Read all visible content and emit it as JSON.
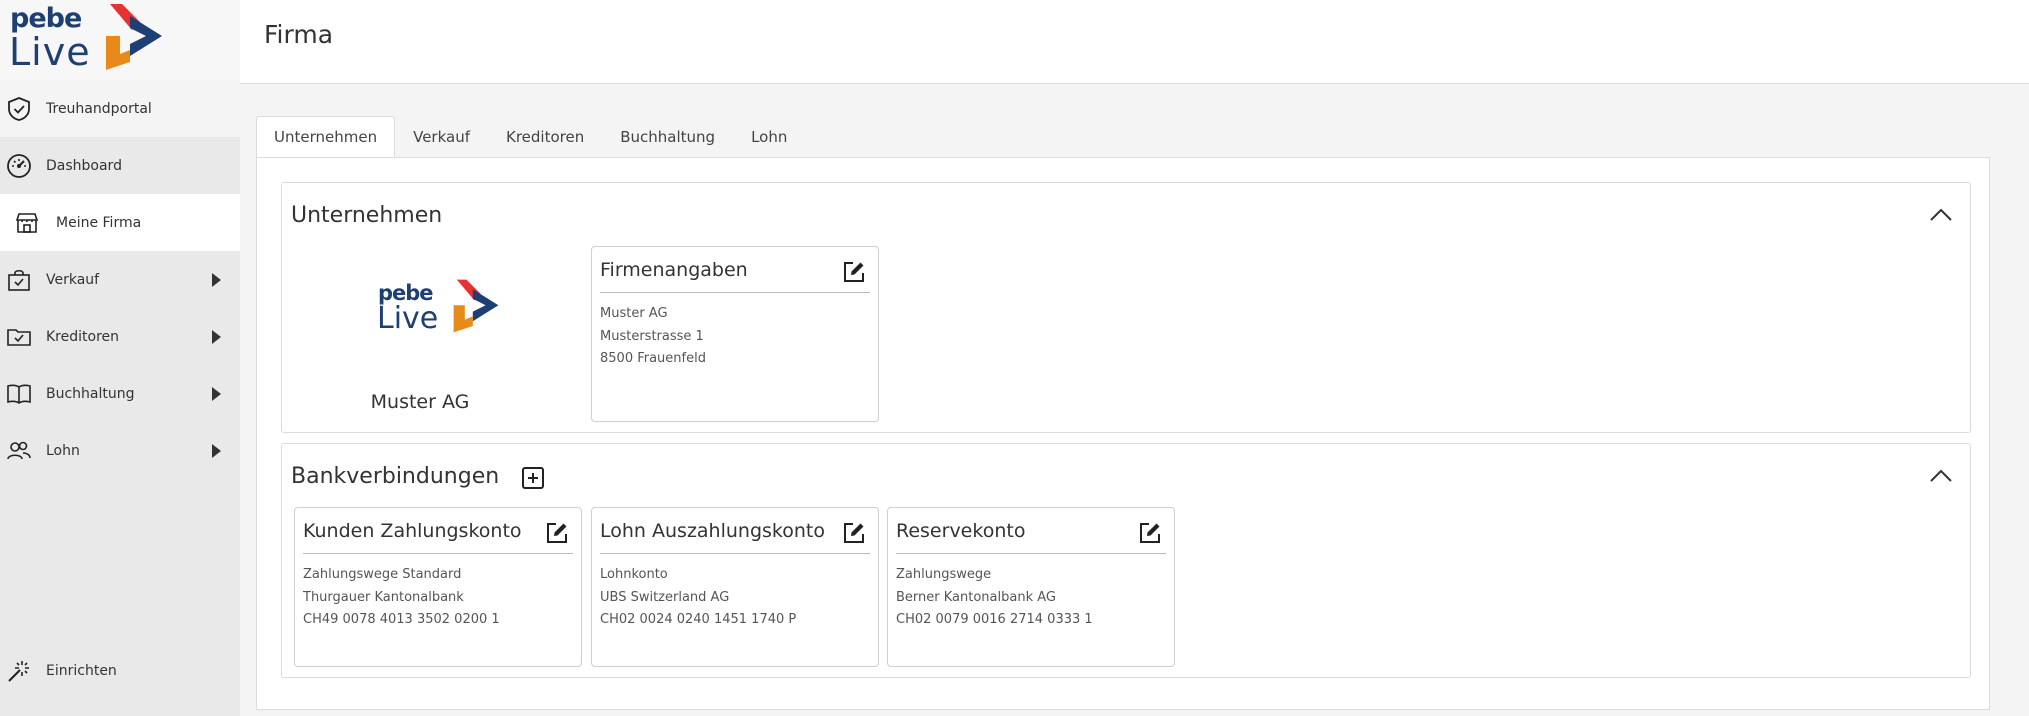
{
  "brand": {
    "logo_pebe": "pebe",
    "logo_live": "Live"
  },
  "sidebar": {
    "items": [
      {
        "label": "Treuhandportal",
        "icon": "shield-check-icon"
      },
      {
        "label": "Dashboard",
        "icon": "gauge-icon"
      },
      {
        "label": "Meine Firma",
        "icon": "storefront-icon"
      },
      {
        "label": "Verkauf",
        "icon": "shopping-bag-icon"
      },
      {
        "label": "Kreditoren",
        "icon": "folder-check-icon"
      },
      {
        "label": "Buchhaltung",
        "icon": "book-icon"
      },
      {
        "label": "Lohn",
        "icon": "users-icon"
      },
      {
        "label": "Einrichten",
        "icon": "magic-wand-icon"
      }
    ]
  },
  "header": {
    "title": "Firma"
  },
  "tabs": [
    {
      "label": "Unternehmen",
      "active": true
    },
    {
      "label": "Verkauf",
      "active": false
    },
    {
      "label": "Kreditoren",
      "active": false
    },
    {
      "label": "Buchhaltung",
      "active": false
    },
    {
      "label": "Lohn",
      "active": false
    }
  ],
  "unternehmen": {
    "title": "Unternehmen",
    "company_name": "Muster AG",
    "logo_pebe": "pebe",
    "logo_live": "Live",
    "firmenangaben": {
      "title": "Firmenangaben",
      "lines": [
        "Muster AG",
        "Musterstrasse 1",
        "8500 Frauenfeld"
      ]
    }
  },
  "bankverbindungen": {
    "title": "Bankverbindungen",
    "cards": [
      {
        "title": "Kunden Zahlungskonto",
        "lines": [
          "Zahlungswege Standard",
          "Thurgauer Kantonalbank",
          "CH49 0078 4013 3502 0200 1"
        ]
      },
      {
        "title": "Lohn Auszahlungskonto",
        "lines": [
          "Lohnkonto",
          "UBS Switzerland AG",
          "CH02 0024 0240 1451 1740 P"
        ]
      },
      {
        "title": "Reservekonto",
        "lines": [
          "Zahlungswege",
          "Berner Kantonalbank AG",
          "CH02 0079 0016 2714 0333 1"
        ]
      }
    ]
  },
  "colors": {
    "brand_blue": "#1d3f73",
    "brand_red": "#e63232",
    "brand_orange": "#e88a1a",
    "sidebar_bg": "#e9e9e9"
  }
}
